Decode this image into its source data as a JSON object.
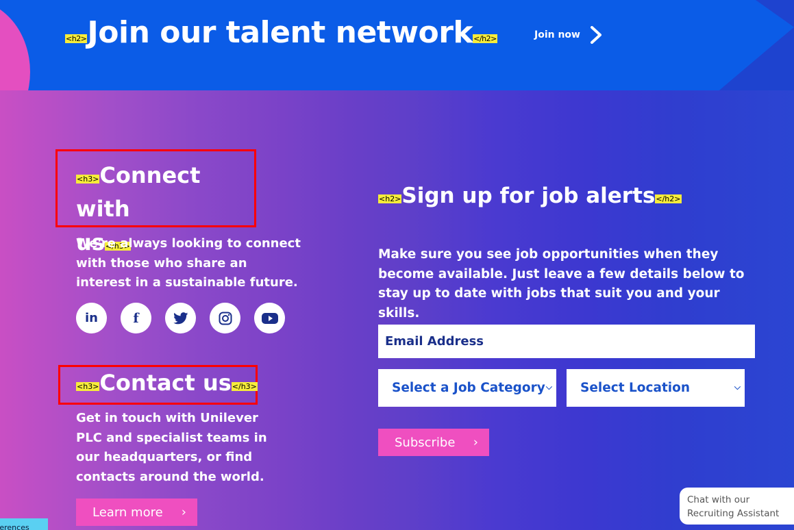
{
  "banner": {
    "tag_open": "<h2>",
    "title": "Join our talent network",
    "tag_close": "</h2>",
    "join_label": "Join now",
    "join_icon": "chevron-right-icon"
  },
  "connect": {
    "tag_open": "<h3>",
    "title_line1": "Connect with",
    "title_line2": "us",
    "tag_close": "</h3>",
    "text": "We're always looking to connect with those who share an interest in a sustainable future."
  },
  "socials": [
    {
      "name": "linkedin-icon",
      "glyph": "in"
    },
    {
      "name": "facebook-icon",
      "glyph": "f"
    },
    {
      "name": "twitter-icon",
      "glyph": "twitter"
    },
    {
      "name": "instagram-icon",
      "glyph": "instagram"
    },
    {
      "name": "youtube-icon",
      "glyph": "youtube"
    }
  ],
  "contact": {
    "tag_open": "<h3>",
    "title": "Contact us",
    "tag_close": "</h3>",
    "text": "Get in touch with Unilever PLC and specialist teams in our headquarters, or find contacts around the world.",
    "button_label": "Learn more",
    "button_icon": "chevron-right-icon"
  },
  "signup": {
    "tag_open": "<h2>",
    "title": "Sign up for job alerts",
    "tag_close": "</h2>",
    "text": "Make sure you see job opportunities when they become available. Just leave a few details below to stay up to date with jobs that suit you and your skills.",
    "email_placeholder": "Email Address",
    "category_selected": "Select a Job Category",
    "location_selected": "Select Location",
    "subscribe_label": "Subscribe",
    "subscribe_icon": "chevron-right-icon"
  },
  "chat": {
    "line1": "Chat with our",
    "line2": "Recruiting Assistant"
  },
  "preferences_label": "Preferences",
  "colors": {
    "banner_blue": "#0b5ce7",
    "pink_button": "#ef4fc0",
    "annotation_yellow": "#f6ec3b",
    "highlight_red": "#ff0000",
    "select_text": "#1a52c9"
  }
}
